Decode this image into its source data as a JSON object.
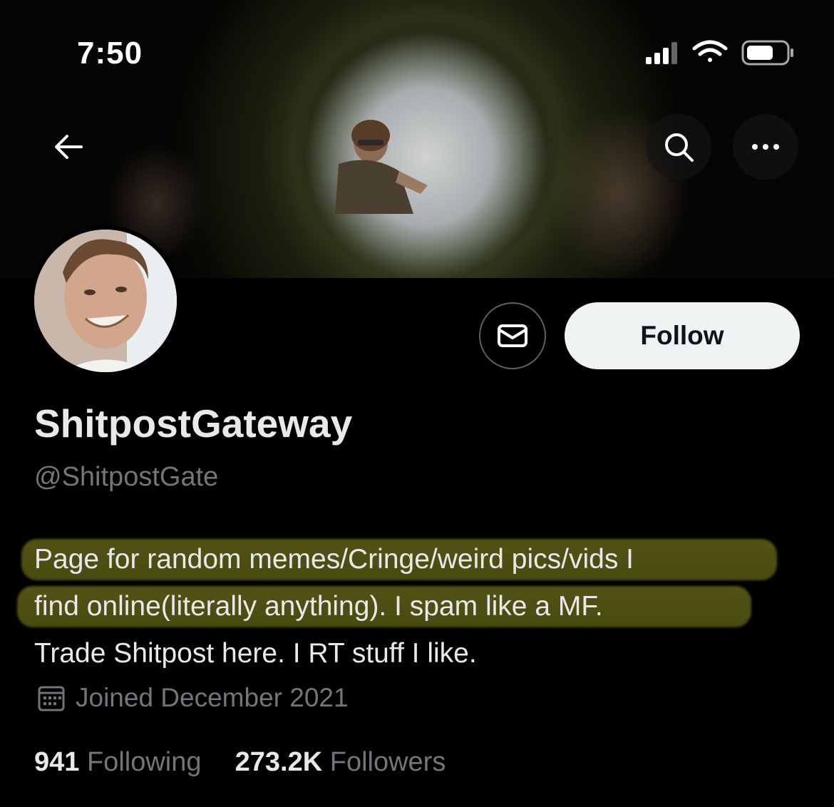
{
  "status_bar": {
    "time": "7:50",
    "icons": [
      "signal-icon",
      "wifi-icon",
      "battery-icon"
    ]
  },
  "header": {
    "back_icon": "arrow-left-icon",
    "search_icon": "search-icon",
    "more_icon": "more-icon"
  },
  "profile": {
    "display_name": "ShitpostGateway",
    "handle": "@ShitpostGate",
    "follow_label": "Follow",
    "message_icon": "envelope-icon",
    "bio_lines": [
      "Page for random memes/Cringe/weird pics/vids I",
      "find online(literally anything). I spam like a MF.",
      "Trade Shitpost here. I RT stuff I like."
    ],
    "joined": "Joined December 2021",
    "following_count": "941",
    "following_label": "Following",
    "followers_count": "273.2K",
    "followers_label": "Followers"
  },
  "colors": {
    "background": "#000000",
    "text_primary": "#e7e9ea",
    "text_secondary": "#71767b",
    "follow_button_bg": "#eff3f4",
    "highlight": "#8a8c20"
  }
}
